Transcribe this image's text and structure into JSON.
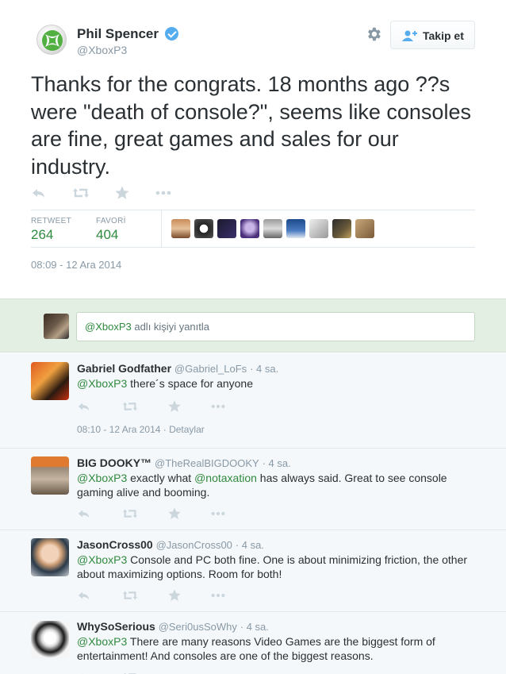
{
  "tweet": {
    "fullname": "Phil Spencer",
    "handle": "@XboxP3",
    "follow_label": "Takip et",
    "text": "Thanks for the congrats. 18 months ago ??s were \"death of console?\", seems like consoles are fine, great games and sales for our industry.",
    "retweet_label": "RETWEET",
    "retweet_count": "264",
    "favorite_label": "FAVORİ",
    "favorite_count": "404",
    "date": "08:09 - 12 Ara 2014"
  },
  "reply_box": {
    "mention": "@XboxP3",
    "placeholder_rest": " adlı kişiyi yanıtla"
  },
  "replies": [
    {
      "name": "Gabriel Godfather",
      "handle": "@Gabriel_LoFs",
      "time": "· 4 sa.",
      "mention": "@XboxP3",
      "text": " there´s space for anyone",
      "date": "08:10 - 12 Ara 2014 · Detaylar"
    },
    {
      "name": "BIG DOOKY™",
      "handle": "@TheRealBIGDOOKY",
      "time": "· 4 sa.",
      "mention": "@XboxP3",
      "text_a": " exactly what ",
      "mention2": "@notaxation",
      "text_b": " has always said. Great to see console gaming alive and booming."
    },
    {
      "name": "JasonCross00",
      "handle": "@JasonCross00",
      "time": "· 4 sa.",
      "mention": "@XboxP3",
      "text": " Console and PC both fine. One is about minimizing friction, the other about maximizing options. Room for both!"
    },
    {
      "name": "WhySoSerious",
      "handle": "@Seri0usSoWhy",
      "time": "· 4 sa.",
      "mention": "@XboxP3",
      "text": " There are many reasons Video Games are the biggest form of entertainment! And consoles are one of the biggest reasons."
    }
  ],
  "icons": [
    "xbox-logo-icon",
    "verified-icon",
    "gear-icon",
    "follow-user-icon",
    "reply-icon",
    "retweet-icon",
    "favorite-icon",
    "more-icon"
  ],
  "colors": {
    "link": "#2f8a3f",
    "reply_bg": "#e3efe3",
    "verified": "#55acee",
    "muted": "#8899a6"
  }
}
